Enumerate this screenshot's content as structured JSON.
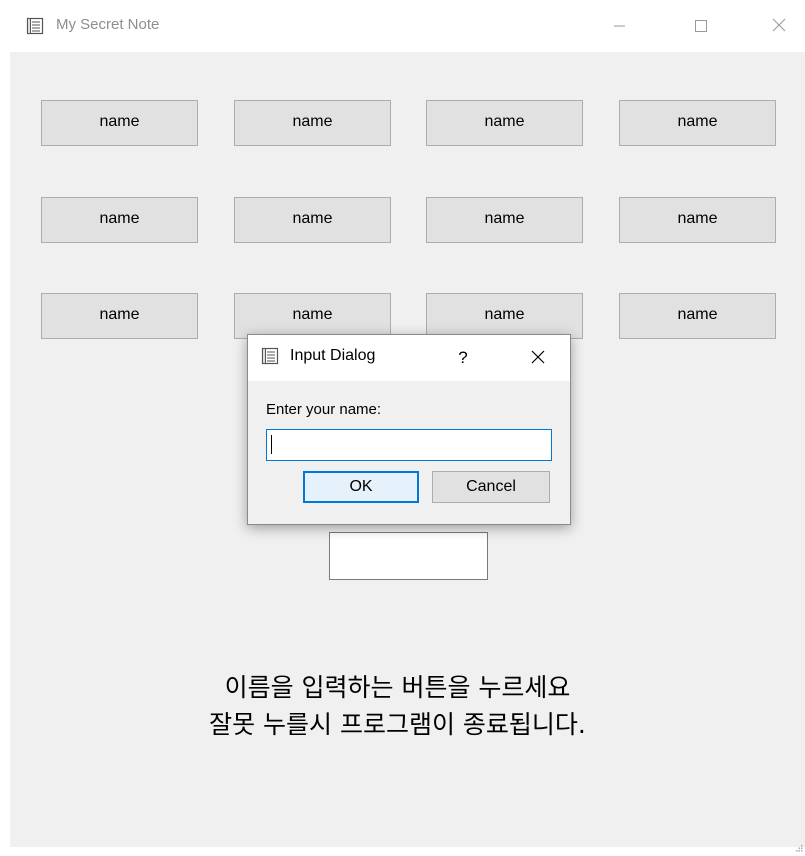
{
  "window": {
    "title": "My Secret Note",
    "icon": "notepad-icon",
    "controls": [
      "minimize-icon",
      "maximize-icon",
      "close-icon"
    ]
  },
  "name_buttons": [
    [
      "name",
      "name",
      "name",
      "name"
    ],
    [
      "name",
      "name",
      "name",
      "name"
    ],
    [
      "name",
      "name",
      "name",
      "name"
    ]
  ],
  "message": {
    "line1": "이름을 입력하는 버튼을 누르세요",
    "line2": "잘못 누를시 프로그램이 종료됩니다."
  },
  "dialog": {
    "title": "Input Dialog",
    "help": "?",
    "label": "Enter your name:",
    "input_value": "",
    "ok_label": "OK",
    "cancel_label": "Cancel"
  },
  "colors": {
    "window_bg": "#f0f0f0",
    "button_bg": "#e1e1e1",
    "focus_accent": "#0078d7"
  }
}
